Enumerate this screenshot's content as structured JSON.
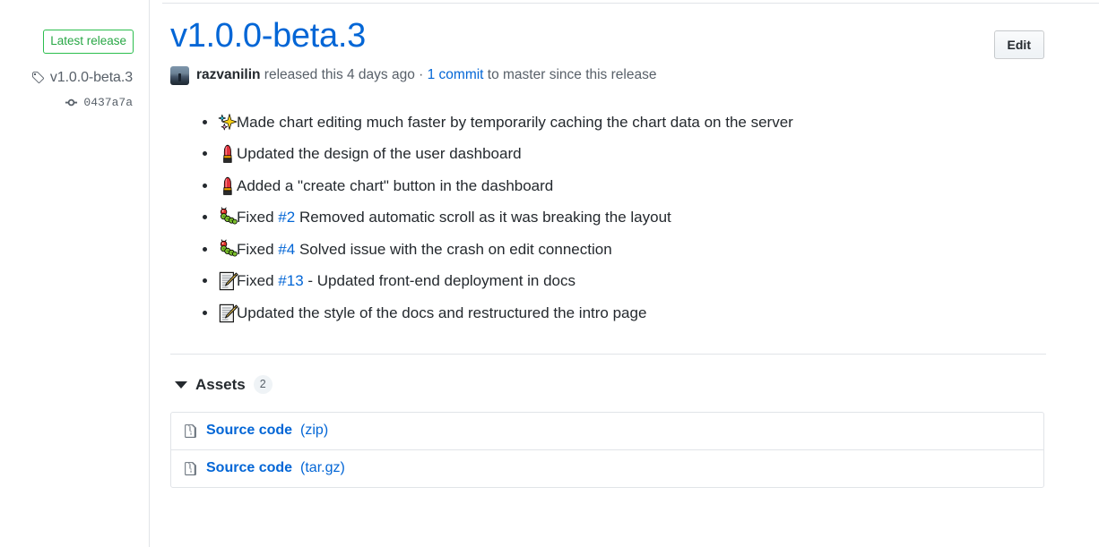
{
  "sidebar": {
    "latest_release_label": "Latest release",
    "tag_icon": "tag-icon",
    "tag_name": "v1.0.0-beta.3",
    "commit_icon": "git-commit-icon",
    "commit_hash": "0437a7a"
  },
  "header": {
    "title": "v1.0.0-beta.3",
    "edit_label": "Edit",
    "author": "razvanilin",
    "released_text": " released this 4 days ago · ",
    "commit_link": "1 commit",
    "since_text": " to master since this release"
  },
  "release_notes": [
    {
      "emoji": "sparkles",
      "prefix": "",
      "link": "",
      "text": "Made chart editing much faster by temporarily caching the chart data on the server"
    },
    {
      "emoji": "lipstick",
      "prefix": "",
      "link": "",
      "text": "Updated the design of the user dashboard"
    },
    {
      "emoji": "lipstick",
      "prefix": "",
      "link": "",
      "text": "Added a \"create chart\" button in the dashboard"
    },
    {
      "emoji": "bug",
      "prefix": "Fixed ",
      "link": "#2",
      "text": " Removed automatic scroll as it was breaking the layout"
    },
    {
      "emoji": "bug",
      "prefix": "Fixed ",
      "link": "#4",
      "text": " Solved issue with the crash on edit connection"
    },
    {
      "emoji": "memo",
      "prefix": "Fixed ",
      "link": "#13",
      "text": " - Updated front-end deployment in docs"
    },
    {
      "emoji": "memo",
      "prefix": "",
      "link": "",
      "text": "Updated the style of the docs and restructured the intro page"
    }
  ],
  "assets": {
    "label": "Assets",
    "count": "2",
    "items": [
      {
        "icon": "file-zip-icon",
        "name": "Source code",
        "ext": "(zip)"
      },
      {
        "icon": "file-zip-icon",
        "name": "Source code",
        "ext": "(tar.gz)"
      }
    ]
  },
  "colors": {
    "link": "#0366d6",
    "green": "#2cbe4e",
    "text": "#24292e",
    "muted": "#586069",
    "border": "#e1e4e8"
  }
}
